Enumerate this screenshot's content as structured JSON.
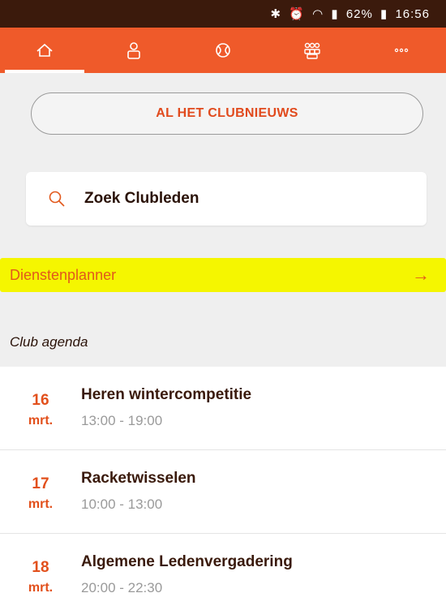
{
  "status_bar": {
    "icons": [
      "bluetooth-icon",
      "alarm-icon",
      "wifi-icon",
      "signal-icon"
    ],
    "battery": "62%",
    "time": "16:56"
  },
  "tabs": [
    {
      "icon": "home-icon",
      "active": true
    },
    {
      "icon": "person-icon",
      "active": false
    },
    {
      "icon": "ball-icon",
      "active": false
    },
    {
      "icon": "group-icon",
      "active": false
    },
    {
      "icon": "more-icon",
      "active": false
    }
  ],
  "news_button": {
    "label": "AL HET CLUBNIEUWS"
  },
  "search": {
    "label": "Zoek Clubleden"
  },
  "planner": {
    "label": "Dienstenplanner",
    "arrow": "→",
    "highlight": "#f5f600"
  },
  "agenda": {
    "title": "Club agenda",
    "items": [
      {
        "day": "16",
        "month": "mrt.",
        "title": "Heren wintercompetitie",
        "time": "13:00 - 19:00"
      },
      {
        "day": "17",
        "month": "mrt.",
        "title": "Racketwisselen",
        "time": "10:00 - 13:00"
      },
      {
        "day": "18",
        "month": "mrt.",
        "title": "Algemene Ledenvergadering",
        "time": "20:00 - 22:30"
      }
    ]
  },
  "colors": {
    "accent": "#ef5a2a",
    "status_bar": "#3b1a0c"
  }
}
